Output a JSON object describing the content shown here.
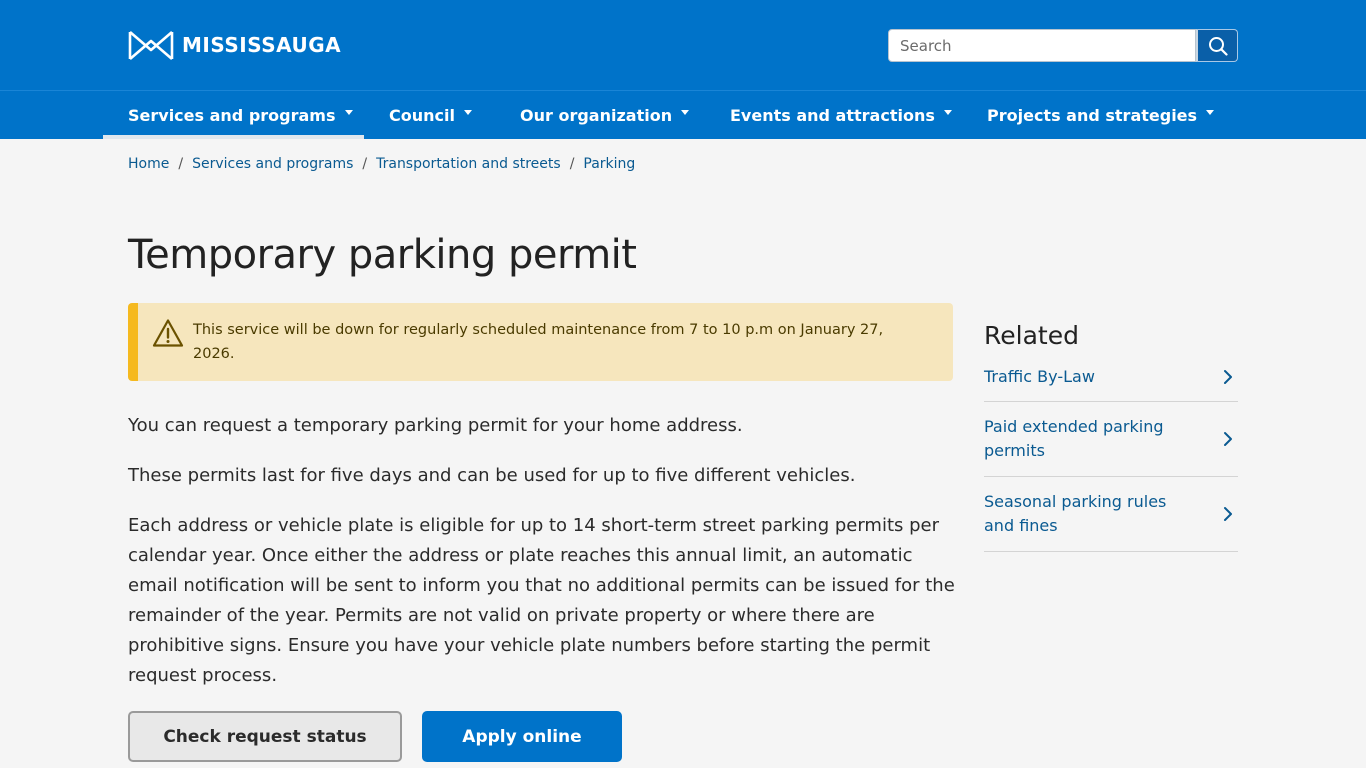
{
  "header": {
    "logo_text": "MISSISSAUGA",
    "search_placeholder": "Search",
    "search_button_label": "Search",
    "brand_color": "#0073c9"
  },
  "nav": {
    "items": [
      {
        "label": "Services and programs",
        "active": true
      },
      {
        "label": "Council",
        "active": false
      },
      {
        "label": "Our organization",
        "active": false
      },
      {
        "label": "Events and attractions",
        "active": false
      },
      {
        "label": "Projects and strategies",
        "active": false
      }
    ]
  },
  "breadcrumb": [
    {
      "label": "Home"
    },
    {
      "label": "Services and programs"
    },
    {
      "label": "Transportation and streets"
    },
    {
      "label": "Parking"
    }
  ],
  "page": {
    "title": "Temporary parking permit"
  },
  "alert": {
    "icon": "warning-icon",
    "text": "This service will be down for regularly scheduled maintenance from 7 to 10 p.m on January 27, 2026."
  },
  "content": {
    "paragraphs": [
      "You can request a temporary parking permit for your home address.",
      "These permits last for five days and can be used for up to five different vehicles.",
      "Each address or vehicle plate is eligible for up to 14 short-term street parking permits per calendar year. Once either the address or plate reaches this annual limit, an automatic email notification will be sent to inform you that no additional permits can be issued for the remainder of the year. Permits are not valid on private property or where there are prohibitive signs. Ensure you have your vehicle plate numbers before starting the permit request process."
    ]
  },
  "buttons": {
    "check_status": "Check request status",
    "apply_online": "Apply online"
  },
  "related": {
    "title": "Related",
    "items": [
      {
        "label": "Traffic By-Law"
      },
      {
        "label": "Paid extended parking permits"
      },
      {
        "label": "Seasonal parking rules and fines"
      }
    ]
  }
}
